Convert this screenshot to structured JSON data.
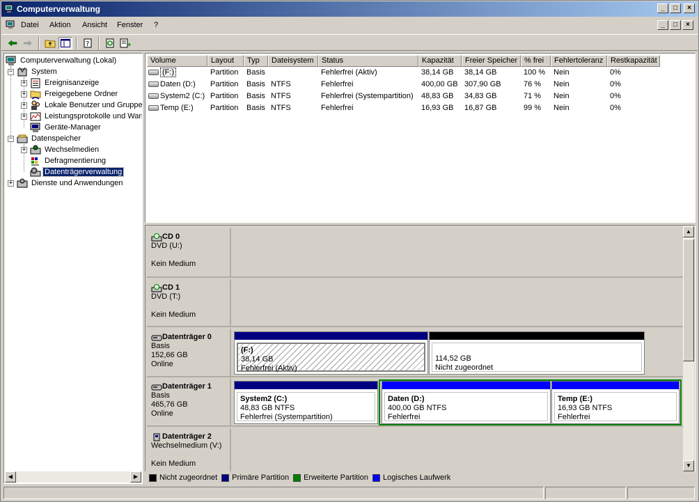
{
  "window": {
    "title": "Computerverwaltung"
  },
  "titlebar_buttons": {
    "minimize": "_",
    "maximize": "□",
    "close": "×"
  },
  "menu": {
    "items": [
      {
        "label": "Datei"
      },
      {
        "label": "Aktion"
      },
      {
        "label": "Ansicht"
      },
      {
        "label": "Fenster"
      },
      {
        "label": "?"
      }
    ]
  },
  "tree": {
    "root": "Computerverwaltung (Lokal)",
    "system": "System",
    "system_children": [
      "Ereignisanzeige",
      "Freigegebene Ordner",
      "Lokale Benutzer und Gruppen",
      "Leistungsprotokolle und Warnungen",
      "Geräte-Manager"
    ],
    "storage": "Datenspeicher",
    "storage_children": [
      "Wechselmedien",
      "Defragmentierung",
      "Datenträgerverwaltung"
    ],
    "services": "Dienste und Anwendungen",
    "selected": "Datenträgerverwaltung"
  },
  "columns": [
    "Volume",
    "Layout",
    "Typ",
    "Dateisystem",
    "Status",
    "Kapazität",
    "Freier Speicher",
    "% frei",
    "Fehlertoleranz",
    "Restkapazität"
  ],
  "volumes": [
    {
      "volume": "(F:)",
      "layout": "Partition",
      "typ": "Basis",
      "fs": "",
      "status": "Fehlerfrei (Aktiv)",
      "cap": "38,14 GB",
      "free": "38,14 GB",
      "pct": "100 %",
      "ft": "Nein",
      "rest": "0%"
    },
    {
      "volume": "Daten (D:)",
      "layout": "Partition",
      "typ": "Basis",
      "fs": "NTFS",
      "status": "Fehlerfrei",
      "cap": "400,00 GB",
      "free": "307,90 GB",
      "pct": "76 %",
      "ft": "Nein",
      "rest": "0%"
    },
    {
      "volume": "System2 (C:)",
      "layout": "Partition",
      "typ": "Basis",
      "fs": "NTFS",
      "status": "Fehlerfrei (Systempartition)",
      "cap": "48,83 GB",
      "free": "34,83 GB",
      "pct": "71 %",
      "ft": "Nein",
      "rest": "0%"
    },
    {
      "volume": "Temp (E:)",
      "layout": "Partition",
      "typ": "Basis",
      "fs": "NTFS",
      "status": "Fehlerfrei",
      "cap": "16,93 GB",
      "free": "16,87 GB",
      "pct": "99 %",
      "ft": "Nein",
      "rest": "0%"
    }
  ],
  "disks": {
    "cd0": {
      "name": "CD 0",
      "line1": "DVD (U:)",
      "line3": "Kein Medium"
    },
    "cd1": {
      "name": "CD 1",
      "line1": "DVD (T:)",
      "line3": "Kein Medium"
    },
    "disk0": {
      "name": "Datenträger 0",
      "type": "Basis",
      "size": "152,66 GB",
      "state": "Online",
      "p1": {
        "name": "(F:)",
        "size": "38,14 GB",
        "status": "Fehlerfrei (Aktiv)"
      },
      "p2": {
        "size": "114,52 GB",
        "status": "Nicht zugeordnet"
      }
    },
    "disk1": {
      "name": "Datenträger 1",
      "type": "Basis",
      "size": "465,76 GB",
      "state": "Online",
      "p1": {
        "name": "System2  (C:)",
        "size": "48,83 GB NTFS",
        "status": "Fehlerfrei (Systempartition)"
      },
      "p2": {
        "name": "Daten  (D:)",
        "size": "400,00 GB NTFS",
        "status": "Fehlerfrei"
      },
      "p3": {
        "name": "Temp  (E:)",
        "size": "16,93 GB NTFS",
        "status": "Fehlerfrei"
      }
    },
    "disk2": {
      "name": "Datenträger 2",
      "line1": "Wechselmedium (V:)",
      "line3": "Kein Medium"
    }
  },
  "legend": [
    {
      "label": "Nicht zugeordnet",
      "color": "#000000"
    },
    {
      "label": "Primäre Partition",
      "color": "#000080"
    },
    {
      "label": "Erweiterte Partition",
      "color": "#008000"
    },
    {
      "label": "Logisches Laufwerk",
      "color": "#0000ff"
    }
  ],
  "colors": {
    "primary": "#000080",
    "logical": "#0000ff",
    "unallocated": "#000000",
    "extended": "#008000"
  }
}
